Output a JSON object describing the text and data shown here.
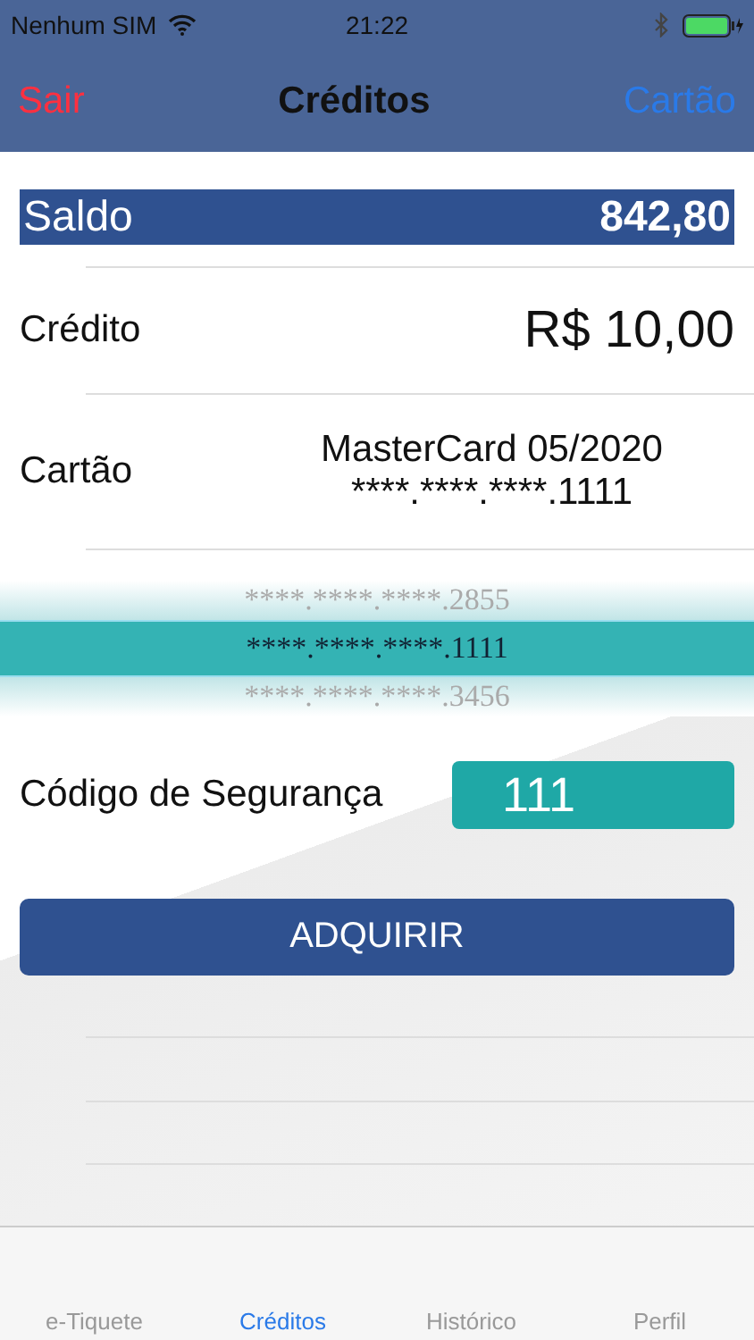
{
  "status_bar": {
    "carrier": "Nenhum SIM",
    "time": "21:22"
  },
  "nav": {
    "left": "Sair",
    "title": "Créditos",
    "right": "Cartão"
  },
  "balance": {
    "label": "Saldo",
    "value": "842,80"
  },
  "credit": {
    "label": "Crédito",
    "value": "R$ 10,00"
  },
  "card": {
    "label": "Cartão",
    "name": "MasterCard 05/2020",
    "number": "****.****.****.1111"
  },
  "picker": {
    "options": [
      {
        "text": "****.****.****.2855",
        "selected": false
      },
      {
        "text": "****.****.****.1111",
        "selected": true
      },
      {
        "text": "****.****.****.3456",
        "selected": false
      }
    ]
  },
  "security": {
    "label": "Código de Segurança",
    "value": "111"
  },
  "action": {
    "label": "ADQUIRIR"
  },
  "tabs": [
    {
      "label": "e-Tiquete",
      "selected": false
    },
    {
      "label": "Créditos",
      "selected": true
    },
    {
      "label": "Histórico",
      "selected": false
    },
    {
      "label": "Perfil",
      "selected": false
    }
  ]
}
